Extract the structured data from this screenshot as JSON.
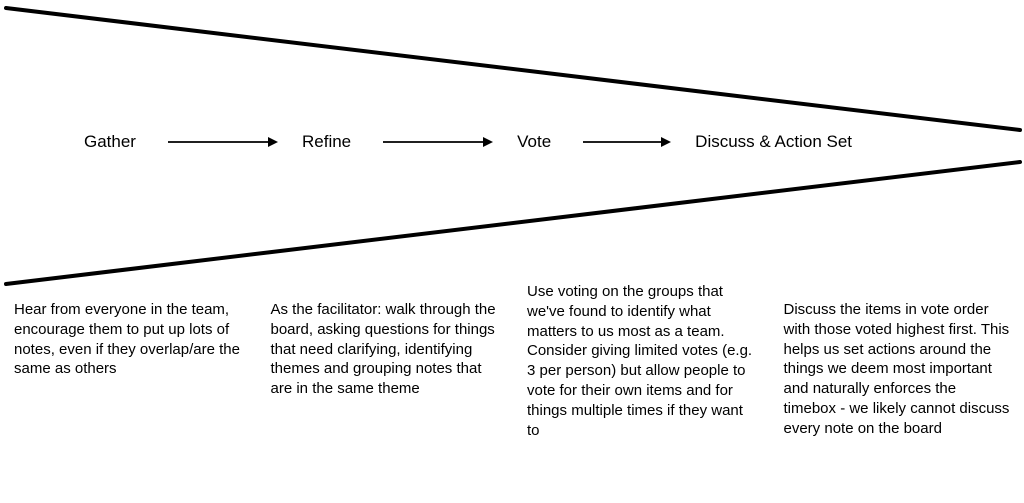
{
  "funnel": {
    "color": "#000000",
    "thickness": 3
  },
  "stages": [
    {
      "label": "Gather",
      "description": "Hear from everyone in the team, encourage them to put up lots of notes, even if they overlap/are the same as others"
    },
    {
      "label": "Refine",
      "description": "As the facilitator: walk through the board, asking questions for things that need clarifying, identifying themes and grouping notes that are in the same theme"
    },
    {
      "label": "Vote",
      "description": "Use voting on the groups that we've found to identify what matters to us most as a team. Consider giving limited votes (e.g. 3 per person) but allow people to vote for their own items and for things multiple times if they want to"
    },
    {
      "label": "Discuss & Action Set",
      "description": "Discuss the items in vote order with those voted highest first. This helps us set actions around the things we deem most important and naturally enforces the timebox - we likely cannot discuss every note on the board"
    }
  ]
}
